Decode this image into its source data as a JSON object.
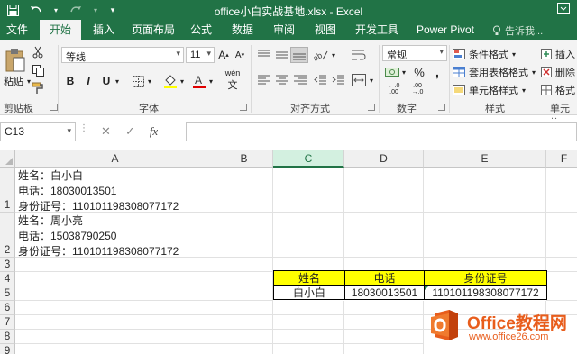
{
  "window": {
    "title": "office小白实战基地.xlsx - Excel"
  },
  "tabs": [
    {
      "label": "文件"
    },
    {
      "label": "开始"
    },
    {
      "label": "插入"
    },
    {
      "label": "页面布局"
    },
    {
      "label": "公式"
    },
    {
      "label": "数据"
    },
    {
      "label": "审阅"
    },
    {
      "label": "视图"
    },
    {
      "label": "开发工具"
    },
    {
      "label": "Power Pivot"
    }
  ],
  "active_tab": "开始",
  "tell_me": "告诉我...",
  "ribbon": {
    "clipboard": {
      "paste_label": "粘贴",
      "group_label": "剪贴板"
    },
    "font": {
      "font_name": "等线",
      "font_size": "11",
      "group_label": "字体",
      "bold": "B",
      "italic": "I",
      "underline": "U",
      "wen": "wén"
    },
    "alignment": {
      "group_label": "对齐方式"
    },
    "number": {
      "format": "常规",
      "group_label": "数字"
    },
    "styles": {
      "conditional": "条件格式",
      "table_format": "套用表格格式",
      "cell_styles": "单元格样式",
      "group_label": "样式"
    },
    "cells": {
      "insert": "插入",
      "delete": "删除",
      "format": "格式",
      "group_label": "单元格"
    }
  },
  "formula_bar": {
    "name_box": "C13",
    "fx": "fx",
    "value": ""
  },
  "grid": {
    "columns": [
      "A",
      "B",
      "C",
      "D",
      "E",
      "F"
    ],
    "selected_column": "C",
    "rows": [
      "1",
      "2",
      "3",
      "4",
      "5",
      "6",
      "7",
      "8",
      "9"
    ],
    "a1_lines": [
      "姓名：白小白",
      "电话：18030013501",
      "身份证号：110101198308077172"
    ],
    "a2_lines": [
      "姓名：周小亮",
      "电话：15038790250",
      "身份证号：110101198308077172"
    ],
    "table_headers": [
      "姓名",
      "电话",
      "身份证号"
    ],
    "table_row": [
      "白小白",
      "18030013501",
      "110101198308077172"
    ]
  },
  "colors": {
    "excel_green": "#217346",
    "header_fill": "#ffff00",
    "watermark": "#e85d1c"
  },
  "watermark": {
    "line1": "Office教程网",
    "line2": "www.office26.com"
  }
}
